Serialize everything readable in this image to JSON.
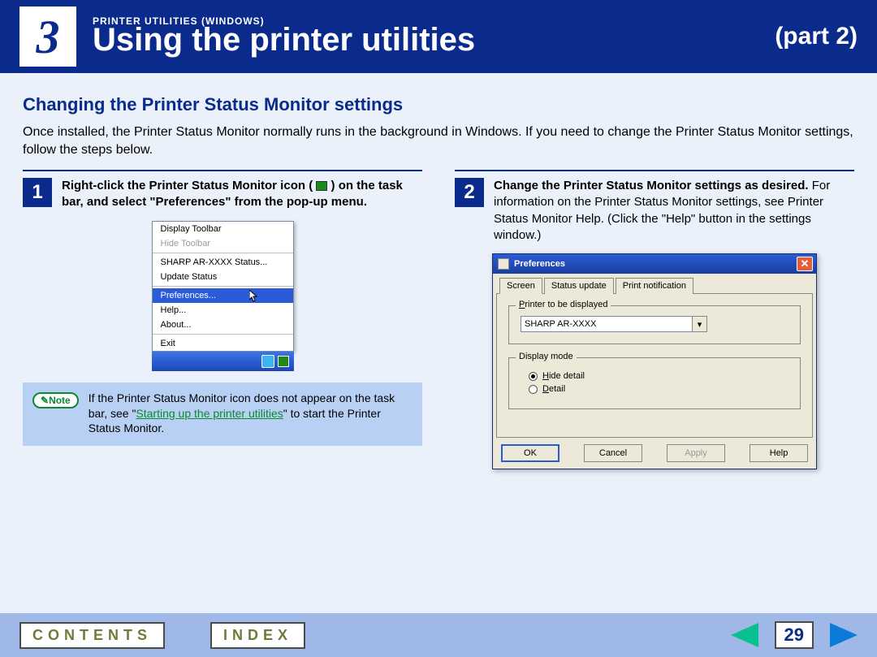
{
  "header": {
    "chapter": "3",
    "breadcrumb": "PRINTER UTILITIES (WINDOWS)",
    "title": "Using the printer utilities",
    "part": "(part 2)"
  },
  "section_heading": "Changing the Printer Status Monitor settings",
  "intro": "Once installed, the Printer Status Monitor normally runs in the background in Windows. If you need to change the Printer Status Monitor settings, follow the steps below.",
  "step1": {
    "num": "1",
    "text_prefix": "Right-click the Printer Status Monitor icon (",
    "text_suffix": ") on the task bar, and select \"Preferences\" from the pop-up menu.",
    "menu": {
      "display_toolbar": "Display Toolbar",
      "hide_toolbar": "Hide Toolbar",
      "status": "SHARP AR-XXXX Status...",
      "update": "Update Status",
      "preferences": "Preferences...",
      "help": "Help...",
      "about": "About...",
      "exit": "Exit"
    },
    "note_label": "Note",
    "note_pre": "If the Printer Status Monitor icon does not appear on the task bar, see \"",
    "note_link": "Starting up the printer utilities",
    "note_post": "\" to start the Printer Status Monitor."
  },
  "step2": {
    "num": "2",
    "bold": "Change the Printer Status Monitor settings as desired.",
    "rest": " For information on the Printer Status Monitor settings, see Printer Status Monitor Help. (Click the \"Help\" button in the settings window.)",
    "dialog": {
      "title": "Preferences",
      "tabs": {
        "screen": "Screen",
        "status_update": "Status update",
        "print_notification": "Print notification"
      },
      "printer_group": "Printer to be displayed",
      "printer_value": "SHARP AR-XXXX",
      "display_group": "Display mode",
      "hide_detail": "Hide detail",
      "detail": "Detail",
      "ok": "OK",
      "cancel": "Cancel",
      "apply": "Apply",
      "help": "Help"
    }
  },
  "footer": {
    "contents": "CONTENTS",
    "index": "INDEX",
    "page": "29"
  }
}
